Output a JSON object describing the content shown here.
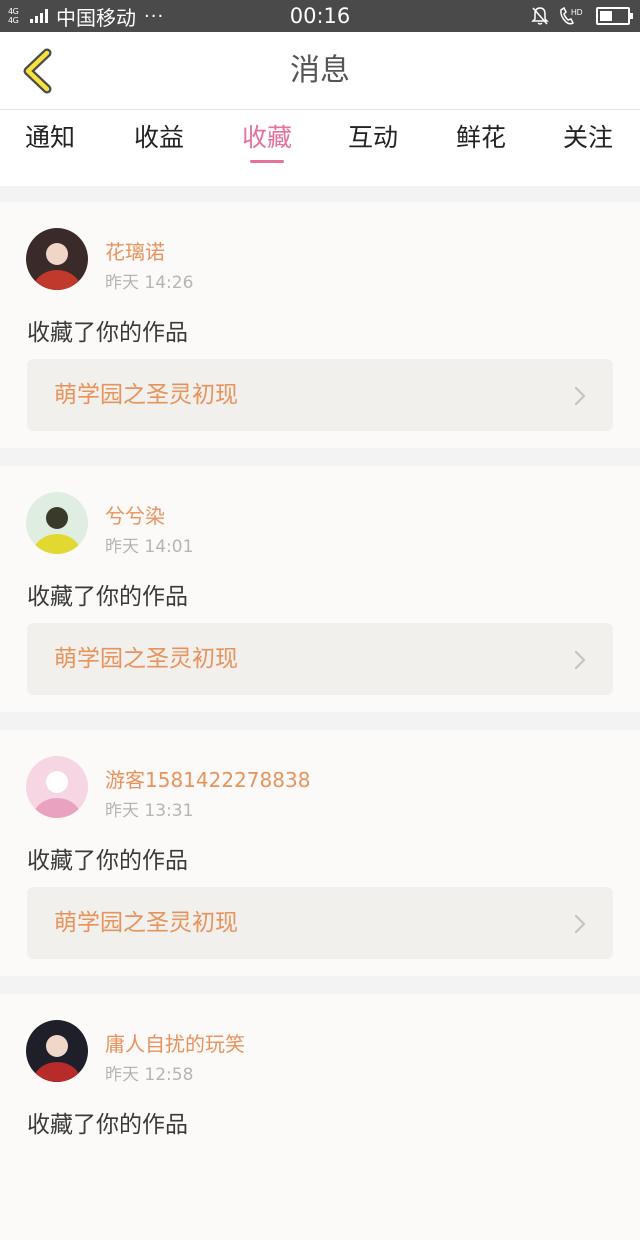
{
  "status_bar": {
    "network": "4G 4G",
    "carrier": "中国移动",
    "dots": "···",
    "time": "00:16",
    "hd": "HD",
    "battery_level": 0.45
  },
  "header": {
    "back_icon": "chevron-left-icon",
    "title": "消息"
  },
  "tabs": [
    {
      "label": "通知",
      "active": false
    },
    {
      "label": "收益",
      "active": false
    },
    {
      "label": "收藏",
      "active": true
    },
    {
      "label": "互动",
      "active": false
    },
    {
      "label": "鲜花",
      "active": false
    },
    {
      "label": "关注",
      "active": false
    }
  ],
  "messages": [
    {
      "user": "花璃诺",
      "time": "昨天 14:26",
      "action": "收藏了你的作品",
      "work": "萌学园之圣灵初现"
    },
    {
      "user": "兮兮染",
      "time": "昨天 14:01",
      "action": "收藏了你的作品",
      "work": "萌学园之圣灵初现"
    },
    {
      "user": "游客1581422278838",
      "time": "昨天 13:31",
      "action": "收藏了你的作品",
      "work": "萌学园之圣灵初现"
    },
    {
      "user": "庸人自扰的玩笑",
      "time": "昨天 12:58",
      "action": "收藏了你的作品",
      "work": ""
    }
  ],
  "colors": {
    "accent": "#e8709d",
    "username": "#e8935c",
    "status_bar": "#4a4a4a"
  }
}
